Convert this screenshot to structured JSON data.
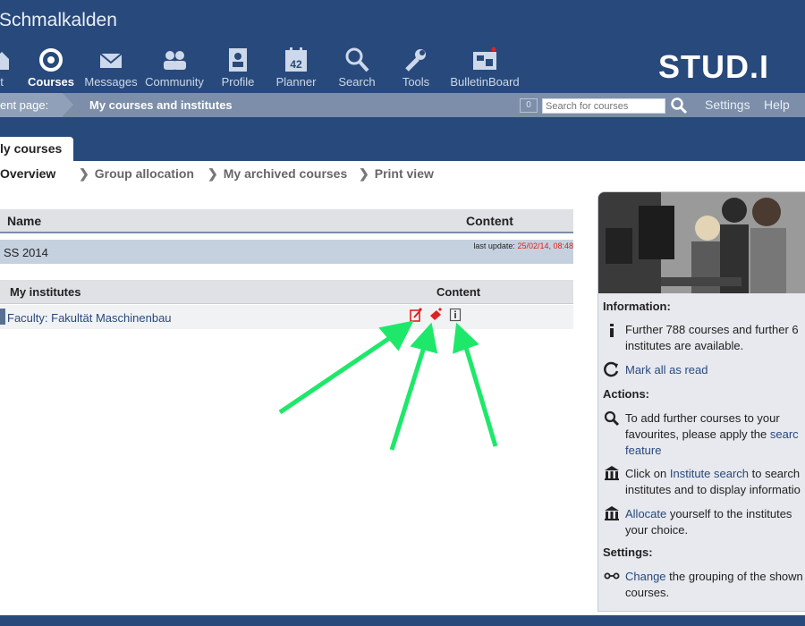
{
  "header": {
    "university": "Schmalkalden",
    "logo": "STUD.I",
    "nav": [
      {
        "label": "t",
        "icon": "home-icon"
      },
      {
        "label": "Courses",
        "icon": "courses-icon",
        "active": true
      },
      {
        "label": "Messages",
        "icon": "envelope-icon"
      },
      {
        "label": "Community",
        "icon": "people-icon"
      },
      {
        "label": "Profile",
        "icon": "profile-icon"
      },
      {
        "label": "Planner",
        "icon": "calendar-icon",
        "badge": "42"
      },
      {
        "label": "Search",
        "icon": "search-icon"
      },
      {
        "label": "Tools",
        "icon": "wrench-icon"
      },
      {
        "label": "BulletinBoard",
        "icon": "bulletinboard-icon"
      }
    ]
  },
  "breadcrumb": {
    "first": "ent page:",
    "current": "My courses and institutes"
  },
  "quicksearch": {
    "count": "0",
    "placeholder": "Search for courses"
  },
  "toplinks": {
    "settings": "Settings",
    "help": "Help"
  },
  "tab": {
    "label": "ly courses"
  },
  "subnav": [
    "Overview",
    "Group allocation",
    "My archived courses",
    "Print view"
  ],
  "courses_table": {
    "col_name": "Name",
    "col_content": "Content",
    "semester": "SS 2014",
    "last_update_label": "last update:",
    "last_update_value": "25/02/14, 08:48"
  },
  "institutes_table": {
    "col_name": "My institutes",
    "col_content": "Content",
    "faculty": "Faculty: Fakultät Maschinenbau"
  },
  "sidebar": {
    "info_heading": "Information:",
    "info_text_1": "Further 788 courses and further 6",
    "info_text_2": "institutes are available.",
    "mark_all": "Mark all as read",
    "actions_heading": "Actions:",
    "act1_line1": "To add further courses to your",
    "act1_line2_pre": "favourites, please apply the ",
    "act1_line2_link": "searc",
    "act1_line3_link": "feature",
    "act2_pre": "Click on ",
    "act2_link": "Institute search",
    "act2_post": " to search",
    "act2_line2": "institutes and to display informatio",
    "act3_link": "Allocate",
    "act3_post": " yourself to the institutes",
    "act3_line2": "your choice.",
    "settings_heading": "Settings:",
    "set_link": "Change",
    "set_post": " the grouping of the shown",
    "set_line2": "courses."
  },
  "colors": {
    "header": "#28497c",
    "breadcrumb": "#7c8ea9",
    "arrow": "#1ee86a",
    "content_icon": "#d22"
  }
}
